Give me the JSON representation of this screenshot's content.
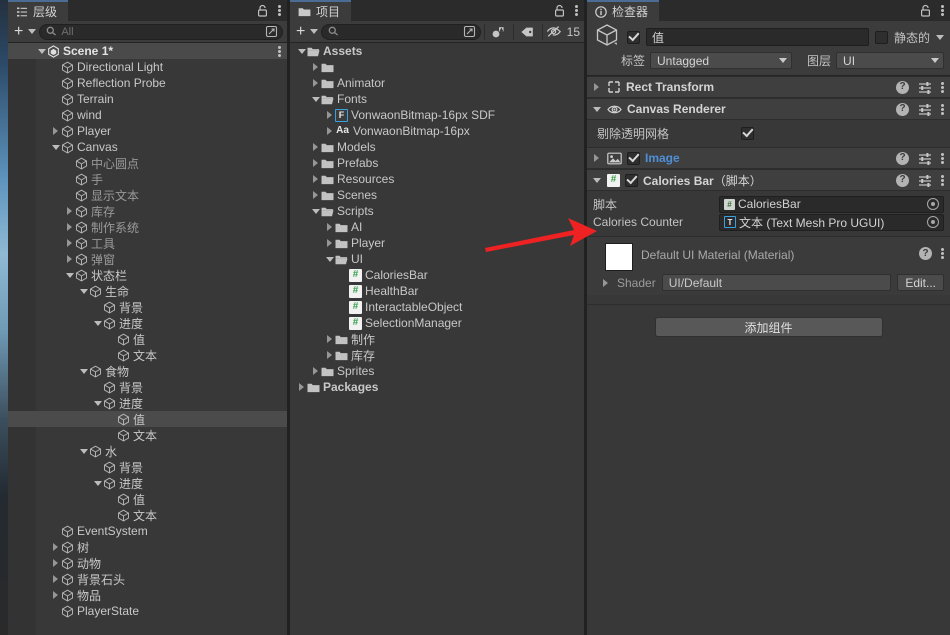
{
  "hierarchy": {
    "tab_label": "层级",
    "tab_icon": "hierarchy-icon",
    "toolbar": {
      "create_label": "+",
      "search_placeholder": "All",
      "search_value": ""
    },
    "items": [
      {
        "label": "Scene 1*",
        "depth": 0,
        "icon": "unity-scene-icon",
        "arrow": "down",
        "kind": "scene"
      },
      {
        "label": "Directional Light",
        "depth": 1,
        "icon": "gameobject-icon",
        "arrow": "none",
        "kind": "go"
      },
      {
        "label": "Reflection Probe",
        "depth": 1,
        "icon": "gameobject-icon",
        "arrow": "none",
        "kind": "go"
      },
      {
        "label": "Terrain",
        "depth": 1,
        "icon": "gameobject-icon",
        "arrow": "none",
        "kind": "go"
      },
      {
        "label": "wind",
        "depth": 1,
        "icon": "gameobject-icon",
        "arrow": "none",
        "kind": "go"
      },
      {
        "label": "Player",
        "depth": 1,
        "icon": "gameobject-icon",
        "arrow": "right",
        "kind": "go"
      },
      {
        "label": "Canvas",
        "depth": 1,
        "icon": "gameobject-icon",
        "arrow": "down",
        "kind": "go"
      },
      {
        "label": "中心圆点",
        "depth": 2,
        "icon": "gameobject-icon",
        "arrow": "none",
        "kind": "go-dim"
      },
      {
        "label": "手",
        "depth": 2,
        "icon": "gameobject-icon",
        "arrow": "none",
        "kind": "go-dim"
      },
      {
        "label": "显示文本",
        "depth": 2,
        "icon": "gameobject-icon",
        "arrow": "none",
        "kind": "go-dim"
      },
      {
        "label": "库存",
        "depth": 2,
        "icon": "gameobject-icon",
        "arrow": "right",
        "kind": "go-dim"
      },
      {
        "label": "制作系统",
        "depth": 2,
        "icon": "gameobject-icon",
        "arrow": "right",
        "kind": "go-dim"
      },
      {
        "label": "工具",
        "depth": 2,
        "icon": "gameobject-icon",
        "arrow": "right",
        "kind": "go-dim"
      },
      {
        "label": "弹窗",
        "depth": 2,
        "icon": "gameobject-icon",
        "arrow": "right",
        "kind": "go-dim"
      },
      {
        "label": "状态栏",
        "depth": 2,
        "icon": "gameobject-icon",
        "arrow": "down",
        "kind": "go"
      },
      {
        "label": "生命",
        "depth": 3,
        "icon": "gameobject-icon",
        "arrow": "down",
        "kind": "go"
      },
      {
        "label": "背景",
        "depth": 4,
        "icon": "gameobject-icon",
        "arrow": "none",
        "kind": "go"
      },
      {
        "label": "进度",
        "depth": 4,
        "icon": "gameobject-icon",
        "arrow": "down",
        "kind": "go"
      },
      {
        "label": "值",
        "depth": 5,
        "icon": "gameobject-icon",
        "arrow": "none",
        "kind": "go"
      },
      {
        "label": "文本",
        "depth": 5,
        "icon": "gameobject-icon",
        "arrow": "none",
        "kind": "go"
      },
      {
        "label": "食物",
        "depth": 3,
        "icon": "gameobject-icon",
        "arrow": "down",
        "kind": "go"
      },
      {
        "label": "背景",
        "depth": 4,
        "icon": "gameobject-icon",
        "arrow": "none",
        "kind": "go"
      },
      {
        "label": "进度",
        "depth": 4,
        "icon": "gameobject-icon",
        "arrow": "down",
        "kind": "go"
      },
      {
        "label": "值",
        "depth": 5,
        "icon": "gameobject-icon",
        "arrow": "none",
        "kind": "selected"
      },
      {
        "label": "文本",
        "depth": 5,
        "icon": "gameobject-icon",
        "arrow": "none",
        "kind": "go"
      },
      {
        "label": "水",
        "depth": 3,
        "icon": "gameobject-icon",
        "arrow": "down",
        "kind": "go"
      },
      {
        "label": "背景",
        "depth": 4,
        "icon": "gameobject-icon",
        "arrow": "none",
        "kind": "go"
      },
      {
        "label": "进度",
        "depth": 4,
        "icon": "gameobject-icon",
        "arrow": "down",
        "kind": "go"
      },
      {
        "label": "值",
        "depth": 5,
        "icon": "gameobject-icon",
        "arrow": "none",
        "kind": "go"
      },
      {
        "label": "文本",
        "depth": 5,
        "icon": "gameobject-icon",
        "arrow": "none",
        "kind": "go"
      },
      {
        "label": "EventSystem",
        "depth": 1,
        "icon": "gameobject-icon",
        "arrow": "none",
        "kind": "go"
      },
      {
        "label": "树",
        "depth": 1,
        "icon": "gameobject-icon",
        "arrow": "right",
        "kind": "go"
      },
      {
        "label": "动物",
        "depth": 1,
        "icon": "gameobject-icon",
        "arrow": "right",
        "kind": "go"
      },
      {
        "label": "背景石头",
        "depth": 1,
        "icon": "gameobject-icon",
        "arrow": "right",
        "kind": "go"
      },
      {
        "label": "物品",
        "depth": 1,
        "icon": "gameobject-icon",
        "arrow": "right",
        "kind": "go"
      },
      {
        "label": "PlayerState",
        "depth": 1,
        "icon": "gameobject-icon",
        "arrow": "none",
        "kind": "go"
      }
    ]
  },
  "project": {
    "tab_label": "项目",
    "tab_icon": "folder-icon",
    "toolbar": {
      "create_label": "+",
      "search_placeholder": "",
      "search_value": "",
      "hidden_count": "15"
    },
    "items": [
      {
        "label": "Assets",
        "depth": 0,
        "icon": "folder-open-icon",
        "arrow": "down",
        "bold": true
      },
      {
        "label": "",
        "depth": 1,
        "icon": "folder-icon",
        "arrow": "right",
        "bold": false
      },
      {
        "label": "Animator",
        "depth": 1,
        "icon": "folder-icon",
        "arrow": "right",
        "bold": false
      },
      {
        "label": "Fonts",
        "depth": 1,
        "icon": "folder-open-icon",
        "arrow": "down",
        "bold": false
      },
      {
        "label": "VonwaonBitmap-16px SDF",
        "depth": 2,
        "icon": "font-sdf-icon",
        "arrow": "right",
        "bold": false
      },
      {
        "label": "VonwaonBitmap-16px",
        "depth": 2,
        "icon": "font-icon",
        "arrow": "right",
        "bold": false
      },
      {
        "label": "Models",
        "depth": 1,
        "icon": "folder-icon",
        "arrow": "right",
        "bold": false
      },
      {
        "label": "Prefabs",
        "depth": 1,
        "icon": "folder-icon",
        "arrow": "right",
        "bold": false
      },
      {
        "label": "Resources",
        "depth": 1,
        "icon": "folder-icon",
        "arrow": "right",
        "bold": false
      },
      {
        "label": "Scenes",
        "depth": 1,
        "icon": "folder-icon",
        "arrow": "right",
        "bold": false
      },
      {
        "label": "Scripts",
        "depth": 1,
        "icon": "folder-open-icon",
        "arrow": "down",
        "bold": false
      },
      {
        "label": "AI",
        "depth": 2,
        "icon": "folder-icon",
        "arrow": "right",
        "bold": false
      },
      {
        "label": "Player",
        "depth": 2,
        "icon": "folder-icon",
        "arrow": "right",
        "bold": false
      },
      {
        "label": "UI",
        "depth": 2,
        "icon": "folder-open-icon",
        "arrow": "down",
        "bold": false
      },
      {
        "label": "CaloriesBar",
        "depth": 3,
        "icon": "csharp-script-icon",
        "arrow": "none",
        "bold": false
      },
      {
        "label": "HealthBar",
        "depth": 3,
        "icon": "csharp-script-icon",
        "arrow": "none",
        "bold": false
      },
      {
        "label": "InteractableObject",
        "depth": 3,
        "icon": "csharp-script-icon",
        "arrow": "none",
        "bold": false
      },
      {
        "label": "SelectionManager",
        "depth": 3,
        "icon": "csharp-script-icon",
        "arrow": "none",
        "bold": false
      },
      {
        "label": "制作",
        "depth": 2,
        "icon": "folder-icon",
        "arrow": "right",
        "bold": false
      },
      {
        "label": "库存",
        "depth": 2,
        "icon": "folder-icon",
        "arrow": "right",
        "bold": false
      },
      {
        "label": "Sprites",
        "depth": 1,
        "icon": "folder-icon",
        "arrow": "right",
        "bold": false
      },
      {
        "label": "Packages",
        "depth": 0,
        "icon": "folder-icon",
        "arrow": "right",
        "bold": true
      }
    ]
  },
  "inspector": {
    "tab_label": "检查器",
    "tab_icon": "info-icon",
    "object": {
      "enabled": true,
      "name": "值",
      "static_label": "静态的",
      "static_checked": false,
      "tag_label": "标签",
      "tag_value": "Untagged",
      "layer_label": "图层",
      "layer_value": "UI"
    },
    "components": [
      {
        "name": "Rect Transform",
        "icon": "rect-transform-icon",
        "expanded": false,
        "has_toggle": false
      },
      {
        "name": "Canvas Renderer",
        "icon": "eye-icon",
        "expanded": true,
        "has_toggle": false
      },
      {
        "name": "Image",
        "icon": "image-icon",
        "expanded": false,
        "has_toggle": true,
        "toggled": true,
        "highlight": true
      },
      {
        "name": "Calories Bar",
        "suffix": "（脚本）",
        "icon": "csharp-script-icon",
        "expanded": true,
        "has_toggle": true,
        "toggled": true
      }
    ],
    "canvas_renderer": {
      "cull_label": "剔除透明网格",
      "cull_checked": true
    },
    "calories_bar": {
      "script_label": "脚本",
      "script_value": "CaloriesBar",
      "counter_label": "Calories Counter",
      "counter_value": "文本 (Text Mesh Pro UGUI)"
    },
    "material": {
      "title": "Default UI Material (Material)",
      "shader_label": "Shader",
      "shader_value": "UI/Default",
      "edit_label": "Edit..."
    },
    "add_component_label": "添加组件"
  },
  "annotation": {
    "arrow_color": "#ee2222",
    "shape": "red-arrow-right"
  }
}
